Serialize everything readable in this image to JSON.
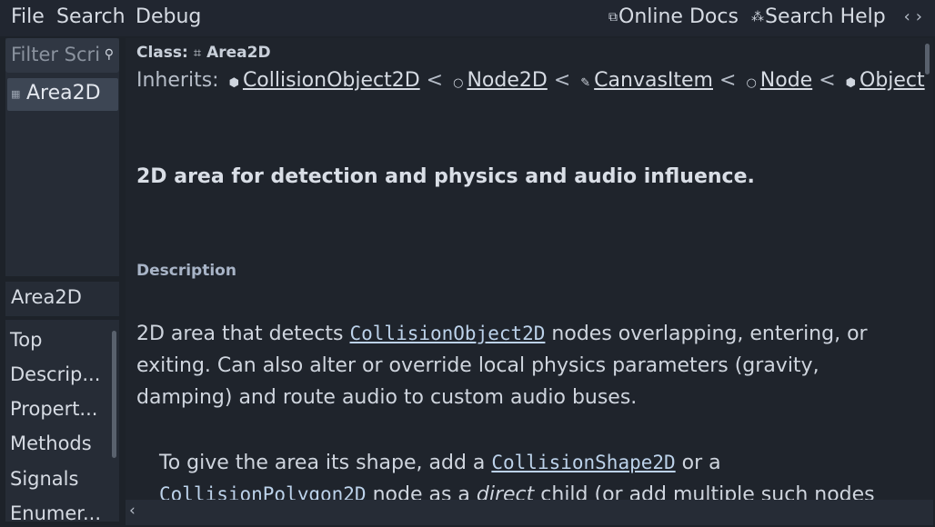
{
  "menubar": {
    "items": [
      "File",
      "Search",
      "Debug"
    ],
    "online_docs": "Online Docs",
    "search_help": "Search Help",
    "back_arrow": "‹",
    "forward_arrow": "›"
  },
  "sidebar": {
    "filter_placeholder": "Filter Scripts",
    "scripts": [
      {
        "label": "Area2D",
        "icon": "class-icon",
        "selected": true
      }
    ]
  },
  "outline": {
    "title": "Area2D",
    "items": [
      "Top",
      "Descrip...",
      "Propert...",
      "Methods",
      "Signals",
      "Enumer..."
    ]
  },
  "doc": {
    "class_prefix": "Class:",
    "class_name": "Area2D",
    "inherits_prefix": "Inherits:",
    "inherits": [
      "CollisionObject2D",
      "Node2D",
      "CanvasItem",
      "Node",
      "Object"
    ],
    "separator": "<",
    "brief": "2D area for detection and physics and audio influence.",
    "section_title": "Description",
    "desc_before": "2D area that detects ",
    "desc_link": "CollisionObject2D",
    "desc_after": " nodes overlapping, entering, or exiting. Can also alter or override local physics parameters (gravity, damping) and route audio to custom audio buses.",
    "p2_before": "To give the area its shape, add a ",
    "p2_link1": "CollisionShape2D",
    "p2_mid": " or a ",
    "p2_link2": "CollisionPolygon2D",
    "p2_mid2": " node as a ",
    "p2_em": "direct",
    "p2_after": " child (or add multiple such nodes"
  },
  "bottom": {
    "arrow": "‹"
  },
  "colors": {
    "background": "#1d2229",
    "panel": "#262c36",
    "selected": "#3d4654",
    "code_link": "#bcd2ea"
  }
}
